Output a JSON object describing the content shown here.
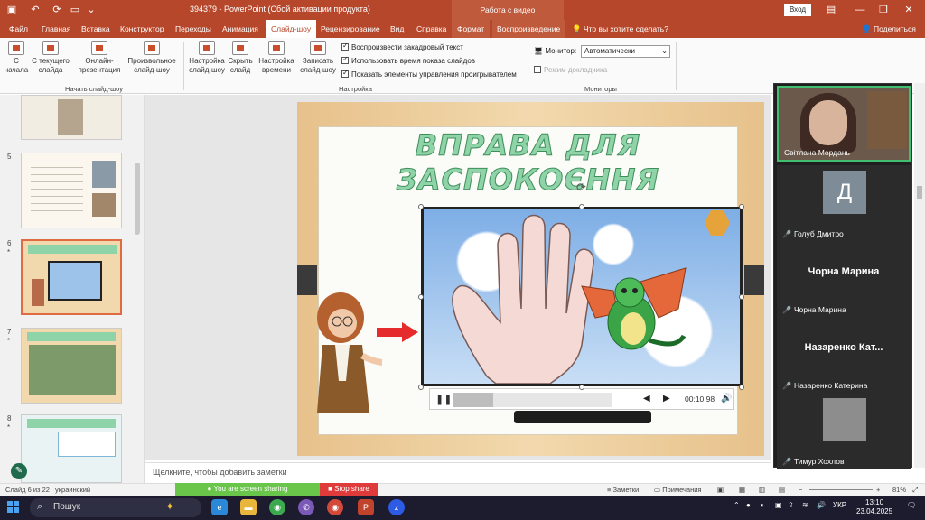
{
  "titlebar": {
    "document_title": "394379 - PowerPoint (Сбой активации продукта)",
    "context_title": "Работа с видео",
    "login_label": "Вход"
  },
  "menu": {
    "tabs": [
      "Файл",
      "Главная",
      "Вставка",
      "Конструктор",
      "Переходы",
      "Анимация",
      "Слайд-шоу",
      "Рецензирование",
      "Вид",
      "Справка",
      "Формат",
      "Воспроизведение"
    ],
    "active_tab": "Слайд-шоу",
    "tell_me": "Что вы хотите сделать?",
    "share": "Поделиться"
  },
  "ribbon": {
    "start_group_label": "Начать слайд-шоу",
    "setup_group_label": "Настройка",
    "monitors_group_label": "Мониторы",
    "btn_from_start": "С начала",
    "btn_from_current": "С текущего слайда",
    "btn_online": "Онлайн-презентация",
    "btn_custom": "Произвольное слайд-шоу",
    "btn_setup": "Настройка слайд-шоу",
    "btn_hide": "Скрыть слайд",
    "btn_rehearse": "Настройка времени",
    "btn_record": "Записать слайд-шоу",
    "chk_narration": "Воспроизвести закадровый текст",
    "chk_timings": "Использовать время показа слайдов",
    "chk_controls": "Показать элементы управления проигрывателем",
    "monitor_label": "Монитор:",
    "monitor_value": "Автоматически",
    "presenter_view": "Режим докладчика"
  },
  "slides": {
    "numbers": [
      "5",
      "6",
      "7",
      "8"
    ],
    "star": "*"
  },
  "slide": {
    "title": "ВПРАВА ДЛЯ ЗАСПОКОЄННЯ",
    "video_time": "00:10,98",
    "video_progress": 0.25
  },
  "notes": {
    "placeholder": "Щелкните, чтобы добавить заметки"
  },
  "call": {
    "participants": [
      {
        "name": "Світлана Мордань",
        "speaking": true
      },
      {
        "name": "Голуб Дмитро",
        "initial": "Д",
        "muted": true
      },
      {
        "name": "Чорна Марина",
        "big": "Чорна Марина",
        "muted": true
      },
      {
        "name": "Назаренко Катерина",
        "big": "Назаренко  Кат...",
        "muted": true
      },
      {
        "name": "Тимур Хохлов",
        "muted": true
      }
    ]
  },
  "status": {
    "slide_counter": "Слайд 6 из 22",
    "language": "украинский",
    "sharing": "You are screen sharing",
    "stop_share": "Stop share",
    "notes_btn": "Заметки",
    "comments_btn": "Примечания",
    "zoom": "81%"
  },
  "taskbar": {
    "search": "Пошук",
    "lang": "УКР",
    "time": "13:10",
    "date": "23.04.2025"
  },
  "colors": {
    "accent": "#b7472a",
    "sharing": "#6ac64b",
    "stop": "#e03b3b"
  }
}
